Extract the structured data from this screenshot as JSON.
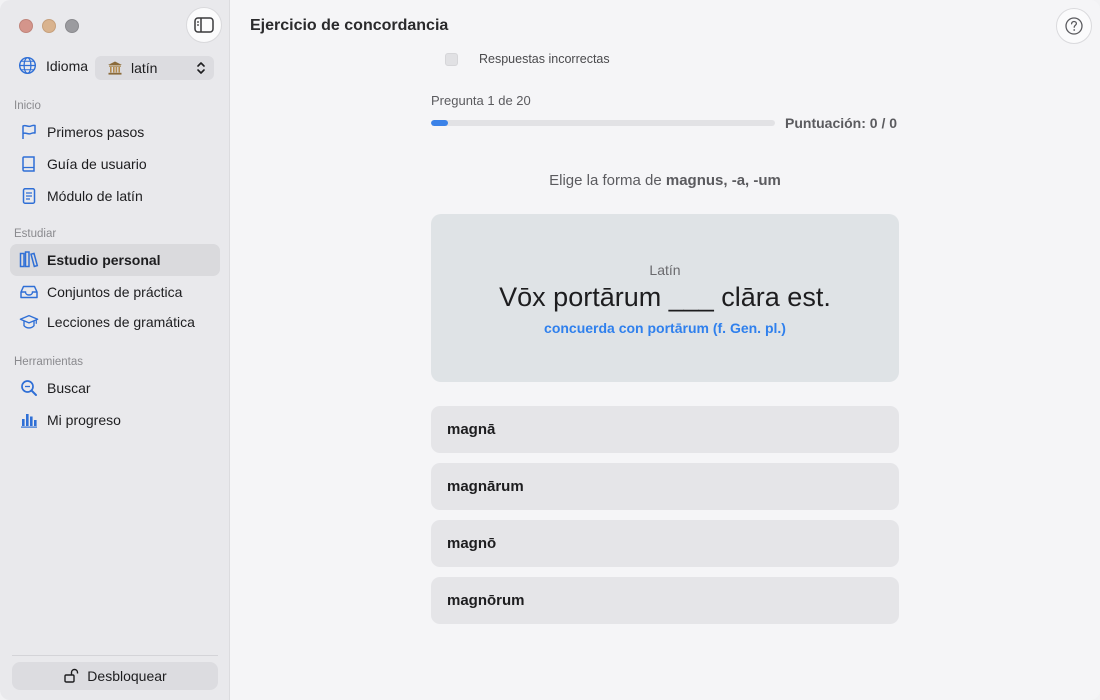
{
  "window": {
    "title": "Ejercicio de concordancia"
  },
  "sidebar": {
    "language_label": "Idioma",
    "language_value": "latín",
    "sections": [
      {
        "title": "Inicio",
        "items": [
          {
            "label": "Primeros pasos",
            "icon": "flag-icon"
          },
          {
            "label": "Guía de usuario",
            "icon": "book-icon"
          },
          {
            "label": "Módulo de latín",
            "icon": "document-icon"
          }
        ]
      },
      {
        "title": "Estudiar",
        "items": [
          {
            "label": "Estudio personal",
            "icon": "books-icon",
            "active": true
          },
          {
            "label": "Conjuntos de práctica",
            "icon": "tray-icon"
          },
          {
            "label": "Lecciones de gramática",
            "icon": "graduation-cap-icon"
          }
        ]
      },
      {
        "title": "Herramientas",
        "items": [
          {
            "label": "Buscar",
            "icon": "magnifier-icon"
          },
          {
            "label": "Mi progreso",
            "icon": "bar-chart-icon"
          }
        ]
      }
    ],
    "unlock_label": "Desbloquear"
  },
  "main": {
    "incorrect_answers_label": "Respuestas incorrectas",
    "question_counter": "Pregunta 1 de 20",
    "progress_fraction": 0.05,
    "score": "Puntuación: 0 / 0",
    "prompt_prefix": "Elige la forma de ",
    "prompt_word": "magnus, -a, -um",
    "card": {
      "language": "Latín",
      "sentence": "Vōx portārum ___ clāra est.",
      "hint": "concuerda con portārum (f. Gen. pl.)"
    },
    "options": [
      "magnā",
      "magnārum",
      "magnō",
      "magnōrum"
    ]
  },
  "colors": {
    "accent": "#3b82e8",
    "hint": "#2f80ed"
  }
}
